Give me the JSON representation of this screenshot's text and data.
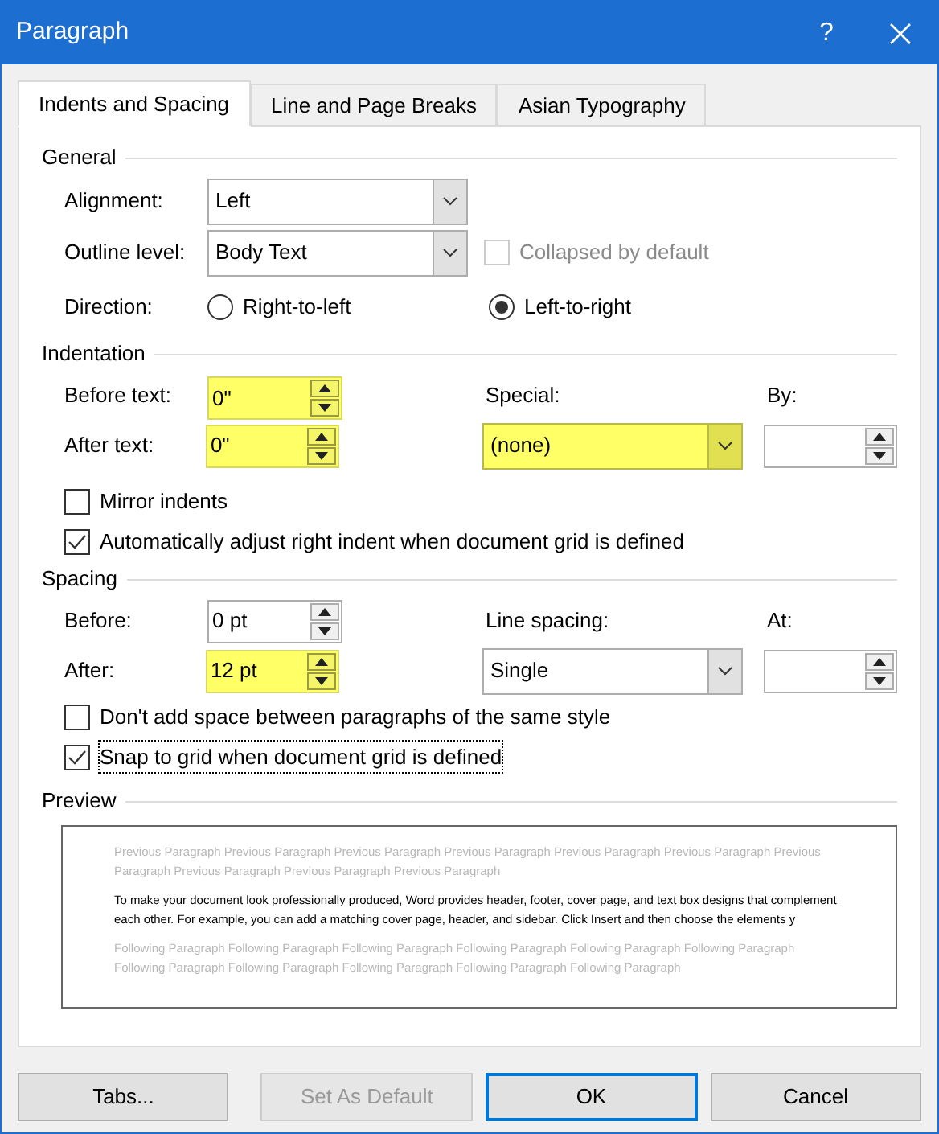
{
  "window": {
    "title": "Paragraph",
    "help": "?"
  },
  "tabs": [
    {
      "label": "Indents and Spacing",
      "selected": true
    },
    {
      "label": "Line and Page Breaks",
      "selected": false
    },
    {
      "label": "Asian Typography",
      "selected": false
    }
  ],
  "general": {
    "heading": "General",
    "alignment": {
      "label": "Alignment:",
      "value": "Left",
      "highlighted": false
    },
    "outline_level": {
      "label": "Outline level:",
      "value": "Body Text",
      "highlighted": false
    },
    "collapsed": {
      "label": "Collapsed by default",
      "checked": false,
      "disabled": true,
      "focused": false
    },
    "direction": {
      "label": "Direction:",
      "options": [
        {
          "label": "Right-to-left",
          "selected": false
        },
        {
          "label": "Left-to-right",
          "selected": true
        }
      ]
    }
  },
  "indentation": {
    "heading": "Indentation",
    "before_text": {
      "label": "Before text:",
      "value": "0\"",
      "highlighted": true
    },
    "after_text": {
      "label": "After text:",
      "value": "0\"",
      "highlighted": true
    },
    "special": {
      "label": "Special:",
      "value": "(none)",
      "highlighted": true
    },
    "by": {
      "label": "By:",
      "highlighted": false
    },
    "checkboxes": [
      {
        "label": "Mirror indents",
        "checked": false,
        "disabled": false,
        "focused": false
      },
      {
        "label": "Automatically adjust right indent when document grid is defined",
        "checked": true,
        "disabled": false,
        "focused": false
      }
    ]
  },
  "spacing": {
    "heading": "Spacing",
    "before": {
      "label": "Before:",
      "value": "0 pt",
      "highlighted": false
    },
    "after": {
      "label": "After:",
      "value": "12 pt",
      "highlighted": true
    },
    "line_spacing": {
      "label": "Line spacing:",
      "value": "Single",
      "highlighted": false
    },
    "at": {
      "label": "At:",
      "highlighted": false
    },
    "checkboxes": [
      {
        "label": "Don't add space between paragraphs of the same style",
        "checked": false,
        "disabled": false,
        "focused": false
      },
      {
        "label": "Snap to grid when document grid is defined",
        "checked": true,
        "disabled": false,
        "focused": true
      }
    ]
  },
  "preview": {
    "heading": "Preview",
    "previous": "Previous Paragraph Previous Paragraph Previous Paragraph Previous Paragraph Previous Paragraph Previous Paragraph Previous Paragraph Previous Paragraph Previous Paragraph Previous Paragraph",
    "sample": "To make your document look professionally produced, Word provides header, footer, cover page, and text box designs that complement each other. For example, you can add a matching cover page, header, and sidebar. Click Insert and then choose the elements y",
    "following": "Following Paragraph Following Paragraph Following Paragraph Following Paragraph Following Paragraph Following Paragraph Following Paragraph Following Paragraph Following Paragraph Following Paragraph Following Paragraph"
  },
  "buttons": [
    {
      "label": "Tabs...",
      "disabled": false,
      "default": false
    },
    {
      "label": "Set As Default",
      "disabled": true,
      "default": false
    },
    {
      "label": "OK",
      "disabled": false,
      "default": true
    },
    {
      "label": "Cancel",
      "disabled": false,
      "default": false
    }
  ]
}
